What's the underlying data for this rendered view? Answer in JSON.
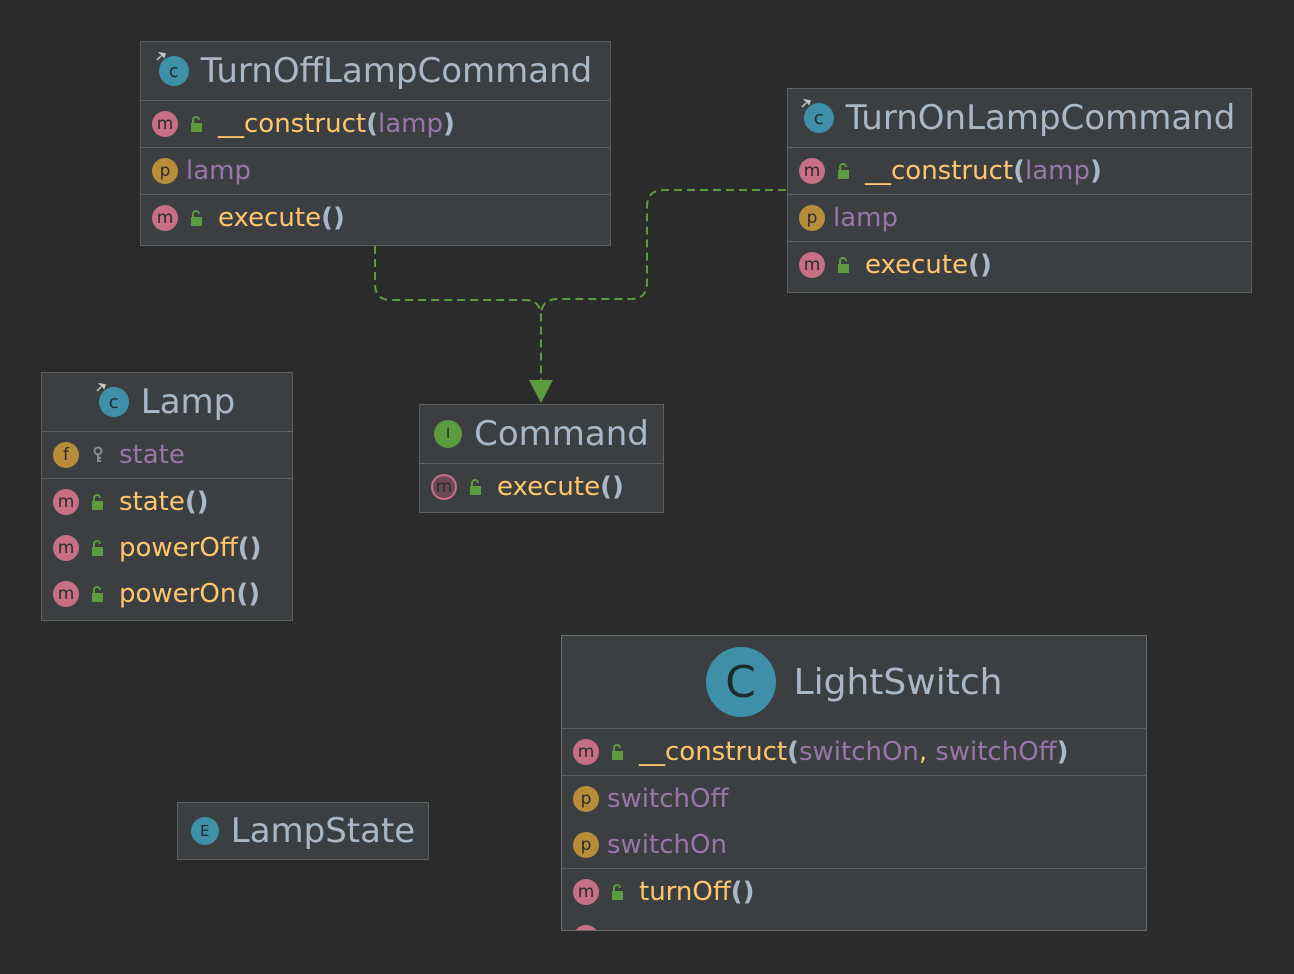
{
  "diagram": {
    "colors": {
      "background": "#2b2b2b",
      "node_fill": "#3c3f41",
      "node_border": "#5e6060",
      "method": "#ffc66d",
      "property": "#9876aa",
      "edge": "#5d9b3f"
    },
    "nodes": {
      "turnoff": {
        "title": "TurnOffLampCommand",
        "kind_icon": "class-icon",
        "members": {
          "m1": {
            "name": "__construct",
            "open": "(",
            "args": "lamp",
            "close": ")"
          },
          "p1": {
            "name": "lamp"
          },
          "m2": {
            "name": "execute",
            "parens": "()"
          }
        }
      },
      "turnon": {
        "title": "TurnOnLampCommand",
        "kind_icon": "class-icon",
        "members": {
          "m1": {
            "name": "__construct",
            "open": "(",
            "args": "lamp",
            "close": ")"
          },
          "p1": {
            "name": "lamp"
          },
          "m2": {
            "name": "execute",
            "parens": "()"
          }
        }
      },
      "lamp": {
        "title": "Lamp",
        "kind_icon": "class-icon",
        "members": {
          "f1": {
            "name": "state"
          },
          "m1": {
            "name": "state",
            "parens": "()"
          },
          "m2": {
            "name": "powerOff",
            "parens": "()"
          },
          "m3": {
            "name": "powerOn",
            "parens": "()"
          }
        }
      },
      "command": {
        "title": "Command",
        "kind_icon": "interface-icon",
        "members": {
          "m1": {
            "name": "execute",
            "parens": "()"
          }
        }
      },
      "lightswitch": {
        "title": "LightSwitch",
        "kind_icon": "class-icon",
        "members": {
          "m1": {
            "name": "__construct",
            "open": "(",
            "args1": "switchOn",
            "comma": ",",
            "args2": "switchOff",
            "close": ")"
          },
          "p1": {
            "name": "switchOff"
          },
          "p2": {
            "name": "switchOn"
          },
          "m2": {
            "name": "turnOff",
            "parens": "()"
          }
        }
      },
      "lampstate": {
        "title": "LampState",
        "kind_icon": "enum-icon"
      }
    },
    "edges": [
      {
        "from": "turnoff",
        "to": "command",
        "type": "implements",
        "style": "dashed"
      },
      {
        "from": "turnon",
        "to": "command",
        "type": "implements",
        "style": "dashed"
      }
    ]
  }
}
